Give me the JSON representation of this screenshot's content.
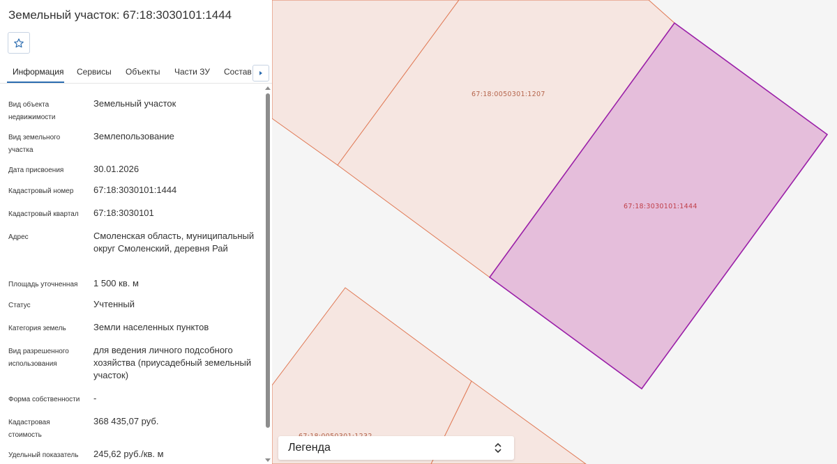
{
  "panel": {
    "title": "Земельный участок: 67:18:3030101:1444",
    "favorite_icon": "star-outline-icon",
    "tabs": [
      {
        "label": "Информация",
        "active": true
      },
      {
        "label": "Сервисы",
        "active": false
      },
      {
        "label": "Объекты",
        "active": false
      },
      {
        "label": "Части ЗУ",
        "active": false
      },
      {
        "label": "Состав",
        "active": false
      }
    ],
    "tabs_next_icon": "caret-right-icon",
    "properties": [
      {
        "label": "Вид объекта недвижимости",
        "value": "Земельный участок"
      },
      {
        "label": "Вид земельного участка",
        "value": "Землепользование"
      },
      {
        "label": "Дата присвоения",
        "value": "30.01.2026"
      },
      {
        "label": "Кадастровый номер",
        "value": "67:18:3030101:1444"
      },
      {
        "label": "Кадастровый квартал",
        "value": "67:18:3030101"
      },
      {
        "label": "Адрес",
        "value": "Смоленская область, муниципальный округ Смоленский, деревня Рай"
      },
      {
        "label": "Площадь уточненная",
        "value": "1 500 кв. м"
      },
      {
        "label": "Статус",
        "value": "Учтенный"
      },
      {
        "label": "Категория земель",
        "value": "Земли населенных пунктов"
      },
      {
        "label": "Вид разрешенного использования",
        "value": "для ведения личного подсобного хозяйства (приусадебный земельный участок)"
      },
      {
        "label": "Форма собственности",
        "value": "-"
      },
      {
        "label": "Кадастровая стоимость",
        "value": "368 435,07 руб."
      },
      {
        "label": "Удельный показатель",
        "value": "245,62 руб./кв. м"
      }
    ]
  },
  "map": {
    "parcel_labels": {
      "neighbor_top": "67:18:0050301:1207",
      "selected": "67:18:3030101:1444",
      "neighbor_bottom": "67:18:0050301:1232"
    },
    "colors": {
      "parcel_fill": "#f6e6e1",
      "parcel_stroke": "#e07a56",
      "selected_fill": "#e5bedb",
      "selected_stroke": "#9a1fa8",
      "label_color": "#b5654c",
      "selected_label_color": "#c0404a",
      "background": "#f5f5f5"
    }
  },
  "legend": {
    "label": "Легенда",
    "icon": "chevron-up-down-icon"
  }
}
